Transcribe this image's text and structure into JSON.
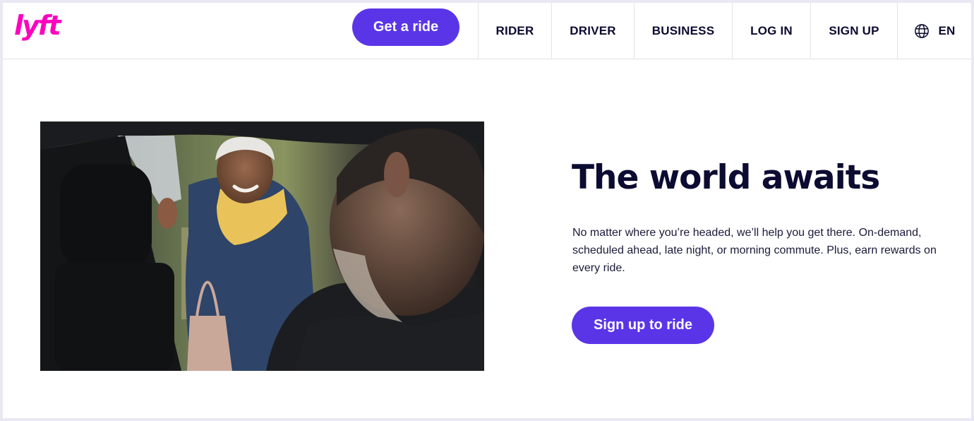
{
  "brand": {
    "logo_text": "lyft",
    "logo_color": "#ff00bf"
  },
  "header": {
    "cta_label": "Get a ride",
    "nav": [
      {
        "label": "RIDER"
      },
      {
        "label": "DRIVER"
      },
      {
        "label": "BUSINESS"
      },
      {
        "label": "LOG IN"
      },
      {
        "label": "SIGN UP"
      }
    ],
    "language": {
      "icon": "globe-icon",
      "label": "EN"
    }
  },
  "hero": {
    "image": "photo-rider-entering-car",
    "title": "The world awaits",
    "description": "No matter where you’re headed, we’ll help you get there. On-demand, scheduled ahead, late night, or morning commute. Plus, earn rewards on every ride.",
    "cta_label": "Sign up to ride"
  },
  "colors": {
    "accent": "#5a35e8",
    "text": "#0c0b31",
    "background": "#ffffff",
    "page_border": "#e9e8f3"
  }
}
